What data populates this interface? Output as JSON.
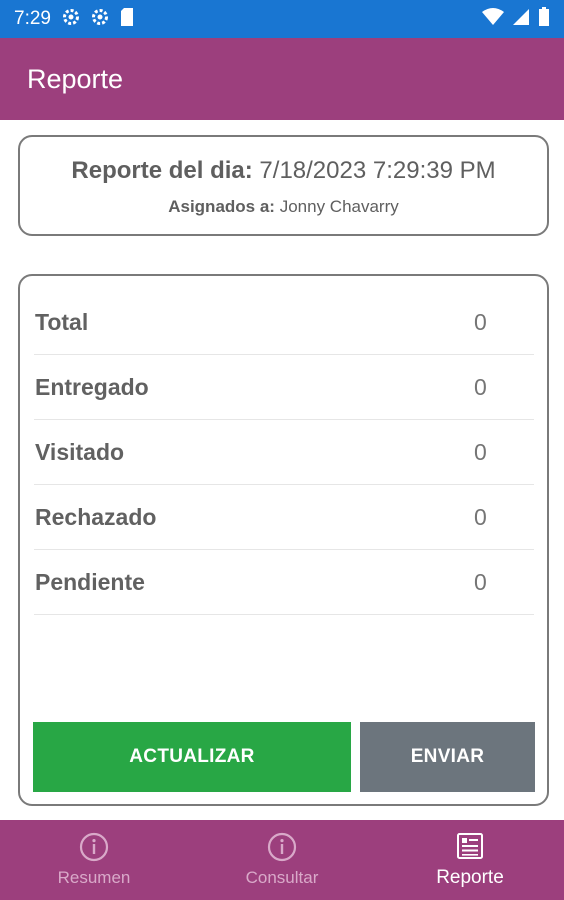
{
  "status_bar": {
    "time": "7:29",
    "left_icons": [
      "settings-icon",
      "settings-icon",
      "sd-card-icon"
    ],
    "right_icons": [
      "wifi-icon",
      "signal-icon",
      "battery-icon"
    ]
  },
  "app_bar": {
    "title": "Reporte"
  },
  "header": {
    "report_label": "Reporte del dia:",
    "report_date": "7/18/2023 7:29:39 PM",
    "assigned_label": "Asignados a:",
    "assigned_name": "Jonny Chavarry"
  },
  "stats": [
    {
      "label": "Total",
      "value": "0"
    },
    {
      "label": "Entregado",
      "value": "0"
    },
    {
      "label": "Visitado",
      "value": "0"
    },
    {
      "label": "Rechazado",
      "value": "0"
    },
    {
      "label": "Pendiente",
      "value": "0"
    }
  ],
  "buttons": {
    "update_label": "ACTUALIZAR",
    "send_label": "ENVIAR"
  },
  "bottom_nav": {
    "items": [
      {
        "label": "Resumen",
        "icon": "info-icon",
        "active": false
      },
      {
        "label": "Consultar",
        "icon": "info-icon",
        "active": false
      },
      {
        "label": "Reporte",
        "icon": "report-icon",
        "active": true
      }
    ]
  },
  "colors": {
    "status_bar": "#1976d2",
    "primary": "#9c3f7d",
    "update_button": "#28a745",
    "send_button": "#6c757d"
  }
}
